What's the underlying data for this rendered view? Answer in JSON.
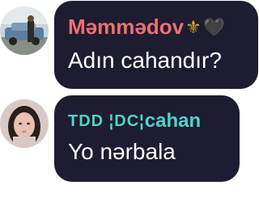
{
  "messages": [
    {
      "sender": "Məmmədov",
      "sender_suffix_icons": [
        "fleur-de-lis-icon",
        "black-heart-icon"
      ],
      "sender_suffix_glyphs": [
        "⚜",
        "🖤"
      ],
      "name_color": "#ef6f73",
      "text": "Adın cahandır?"
    },
    {
      "sender_prefix": "TDD ¦DC¦",
      "sender": "cahan",
      "name_color": "#4fd3c9",
      "text": "Yo nərbala"
    }
  ],
  "bubble_color": "#1e1c30"
}
